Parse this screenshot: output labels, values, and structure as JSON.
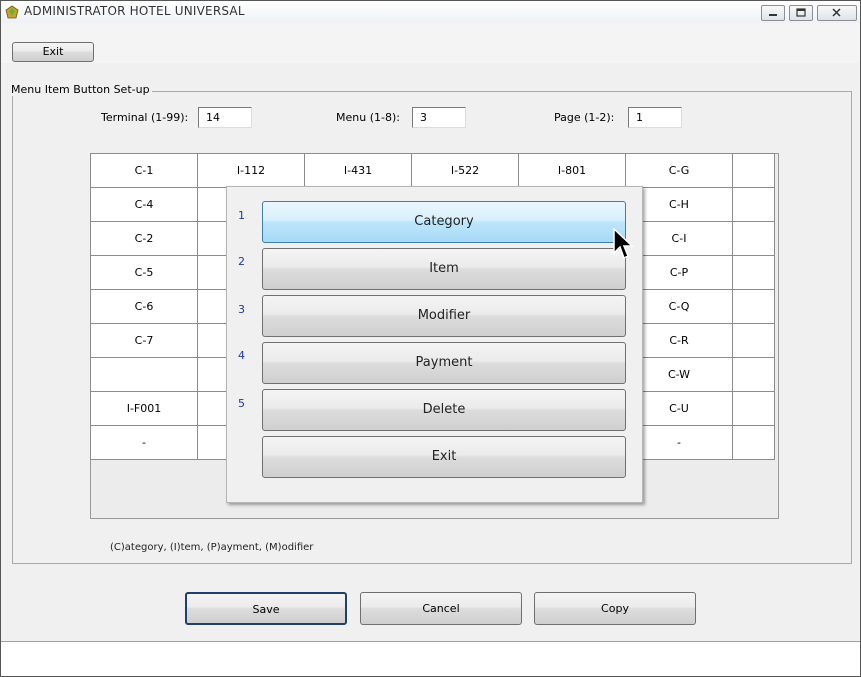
{
  "window": {
    "title": "ADMINISTRATOR HOTEL UNIVERSAL",
    "icon": "hotel-app-icon",
    "controls": [
      "minimize-icon",
      "maximize-icon",
      "close-icon"
    ]
  },
  "toolbar": {
    "exit_label": "Exit"
  },
  "group": {
    "label": "Menu Item Button Set-up",
    "terminal_label": "Terminal (1-99):",
    "terminal_value": "14",
    "menu_label": "Menu (1-8):",
    "menu_value": "3",
    "page_label": "Page (1-2):",
    "page_value": "1"
  },
  "grid": {
    "rows": [
      [
        "C-1",
        "I-112",
        "I-431",
        "I-522",
        "I-801",
        "C-G",
        ""
      ],
      [
        "C-4",
        "",
        "",
        "",
        "",
        "C-H",
        ""
      ],
      [
        "C-2",
        "",
        "",
        "",
        "",
        "C-I",
        ""
      ],
      [
        "C-5",
        "",
        "",
        "",
        "",
        "C-P",
        ""
      ],
      [
        "C-6",
        "",
        "",
        "",
        "",
        "C-Q",
        ""
      ],
      [
        "C-7",
        "",
        "",
        "",
        "",
        "C-R",
        ""
      ],
      [
        "",
        "",
        "",
        "",
        "",
        "C-W",
        ""
      ],
      [
        "I-F001",
        "",
        "",
        "",
        "",
        "C-U",
        ""
      ],
      [
        "-",
        "",
        "",
        "",
        "",
        "-",
        ""
      ]
    ]
  },
  "popup": {
    "options": [
      {
        "number": "1",
        "label": "Category",
        "selected": true
      },
      {
        "number": "2",
        "label": "Item",
        "selected": false
      },
      {
        "number": "3",
        "label": "Modifier",
        "selected": false
      },
      {
        "number": "4",
        "label": "Payment",
        "selected": false
      },
      {
        "number": "5",
        "label": "Delete",
        "selected": false
      }
    ],
    "exit_label": "Exit"
  },
  "legend": "(C)ategory, (I)tem, (P)ayment, (M)odifier",
  "buttons": {
    "save": "Save",
    "cancel": "Cancel",
    "copy": "Copy"
  },
  "colors": {
    "selected_button": "#bee6fd",
    "option_number": "#1a3aa8"
  }
}
